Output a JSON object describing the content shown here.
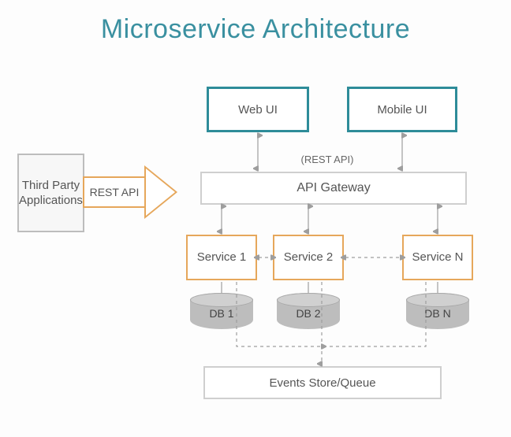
{
  "title": "Microservice Architecture",
  "third_party": "Third Party Applications",
  "rest_api_arrow": "REST API",
  "rest_api_label": "(REST API)",
  "clients": {
    "web": "Web UI",
    "mobile": "Mobile UI"
  },
  "gateway": "API Gateway",
  "services": {
    "s1": "Service 1",
    "s2": "Service 2",
    "sn": "Service N"
  },
  "databases": {
    "db1": "DB 1",
    "db2": "DB 2",
    "dbn": "DB N"
  },
  "events": "Events Store/Queue"
}
